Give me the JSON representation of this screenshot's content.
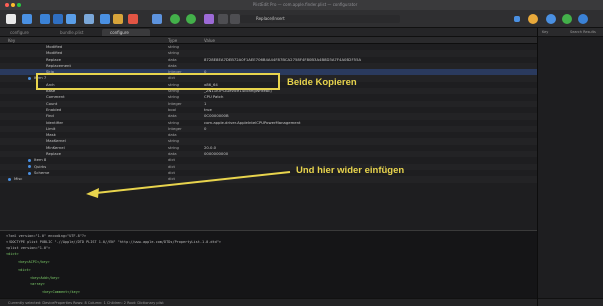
{
  "window": {
    "title": "PlistEdit Pro — com.apple.finder.plist — configurator"
  },
  "toolbar": {
    "search_placeholder": "Replace/Insert"
  },
  "tabs": [
    {
      "label": "configure",
      "active": false
    },
    {
      "label": "bundle.plist",
      "active": false
    },
    {
      "label": "configure",
      "active": true
    }
  ],
  "side_panel": {
    "col1": "Key",
    "col2": "Search Results"
  },
  "columns": {
    "key": "Key",
    "type": "Type",
    "value": "Value"
  },
  "rows": [
    {
      "key": "Modified",
      "type": "string",
      "value": "",
      "indent": 1
    },
    {
      "key": "Modified",
      "type": "string",
      "value": "",
      "indent": 1
    },
    {
      "key": "Replace",
      "type": "data",
      "value": "8728E8EA7DEB72A0F1AEE706B4A44F87BCA2758F4F80B3A4B8D3A7F4A0B2F55A",
      "indent": 1
    },
    {
      "key": "Replacement",
      "type": "data",
      "value": "",
      "indent": 1
    },
    {
      "key": "Skip",
      "type": "Integer",
      "value": "0",
      "indent": 1,
      "selected": true
    },
    {
      "key": "Item 7",
      "type": "dict",
      "value": "",
      "indent": 0,
      "bullet": true
    },
    {
      "key": "Arch",
      "type": "string",
      "value": "x86_64",
      "indent": 1
    },
    {
      "key": "Base",
      "type": "string",
      "value": "_ZN11IOPCIDevice14configWrite8Ej",
      "indent": 1
    },
    {
      "key": "Comment",
      "type": "string",
      "value": "CPU Patch",
      "indent": 1
    },
    {
      "key": "Count",
      "type": "Integer",
      "value": "1",
      "indent": 1
    },
    {
      "key": "Enabled",
      "type": "bool",
      "value": "true",
      "indent": 1
    },
    {
      "key": "Find",
      "type": "data",
      "value": "0C0000000B",
      "indent": 1
    },
    {
      "key": "Identifier",
      "type": "string",
      "value": "com.apple.driver.AppleIntelCPUPowerManagement",
      "indent": 1
    },
    {
      "key": "Limit",
      "type": "Integer",
      "value": "0",
      "indent": 1
    },
    {
      "key": "Mask",
      "type": "data",
      "value": "",
      "indent": 1
    },
    {
      "key": "MaxKernel",
      "type": "string",
      "value": "",
      "indent": 1
    },
    {
      "key": "MinKernel",
      "type": "string",
      "value": "20.0.0",
      "indent": 1
    },
    {
      "key": "Replace",
      "type": "data",
      "value": "0000000000",
      "indent": 1
    },
    {
      "key": "Item 8",
      "type": "dict",
      "value": "",
      "indent": 0,
      "bullet": true
    },
    {
      "key": "Quirks",
      "type": "dict",
      "value": "",
      "indent": 0,
      "bullet": true
    },
    {
      "key": "Scheme",
      "type": "dict",
      "value": "",
      "indent": 0,
      "bullet": true
    },
    {
      "key": "Misc",
      "type": "dict",
      "value": "",
      "indent": -1,
      "bullet": true
    }
  ],
  "xml": [
    "<?xml version=\"1.0\" encoding=\"UTF-8\"?>",
    "<!DOCTYPE plist PUBLIC \"-//Apple//DTD PLIST 1.0//EN\" \"http://www.apple.com/DTDs/PropertyList-1.0.dtd\">",
    "<plist version=\"1.0\">",
    "<dict>",
    "<key>ACPI</key>",
    "<dict>",
    "<key>Add</key>",
    "<array>",
    "<key>Comment</key>"
  ],
  "status": "Currently selected: DeviceProperties   Rows: 8   Column: 1   Children: 2   Root: Dictionary   plist",
  "annotations": {
    "copy_both": "Beide Kopieren",
    "paste_here": "Und hier wider einfügen"
  },
  "colors": {
    "annotation": "#e8d44d",
    "accent": "#4a90e2"
  }
}
